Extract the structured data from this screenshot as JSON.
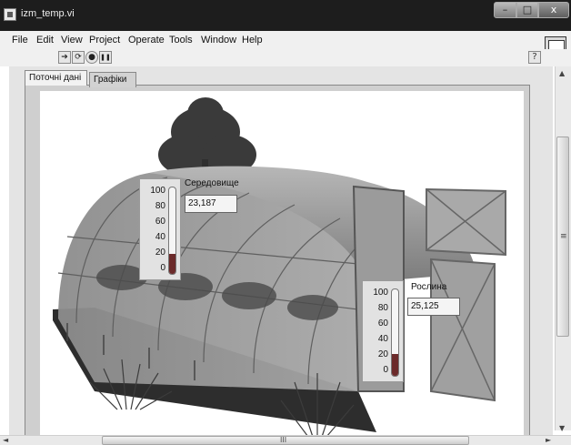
{
  "window": {
    "title": "izm_temp.vi",
    "min_glyph": "–",
    "max_glyph": "□",
    "close_glyph": "x"
  },
  "menu": [
    "File",
    "Edit",
    "View",
    "Project",
    "Operate",
    "Tools",
    "Window",
    "Help"
  ],
  "toolbar": {
    "run_glyph": "➔",
    "run_continuous_glyph": "⟳",
    "abort_glyph": "●",
    "pause_glyph": "❚❚",
    "help_glyph": "?"
  },
  "tabs": [
    {
      "label": "Поточні дані",
      "active": true
    },
    {
      "label": "Графіки",
      "active": false
    }
  ],
  "thermometers": [
    {
      "label": "Середовище",
      "value": "23,187",
      "level_fraction": 0.23,
      "ticks": [
        "100",
        "80",
        "60",
        "40",
        "20",
        "0"
      ]
    },
    {
      "label": "Рослина",
      "value": "25,125",
      "level_fraction": 0.25,
      "ticks": [
        "100",
        "80",
        "60",
        "40",
        "20",
        "0"
      ]
    }
  ],
  "scroll": {
    "h_grip": "III",
    "v_grip": "≡",
    "up": "▲",
    "down": "▼",
    "left": "◄",
    "right": "►"
  },
  "colors": {
    "titlebar": "#1d1d1d",
    "mercury": "#6b2a2a",
    "panel": "#e4e4e4"
  }
}
